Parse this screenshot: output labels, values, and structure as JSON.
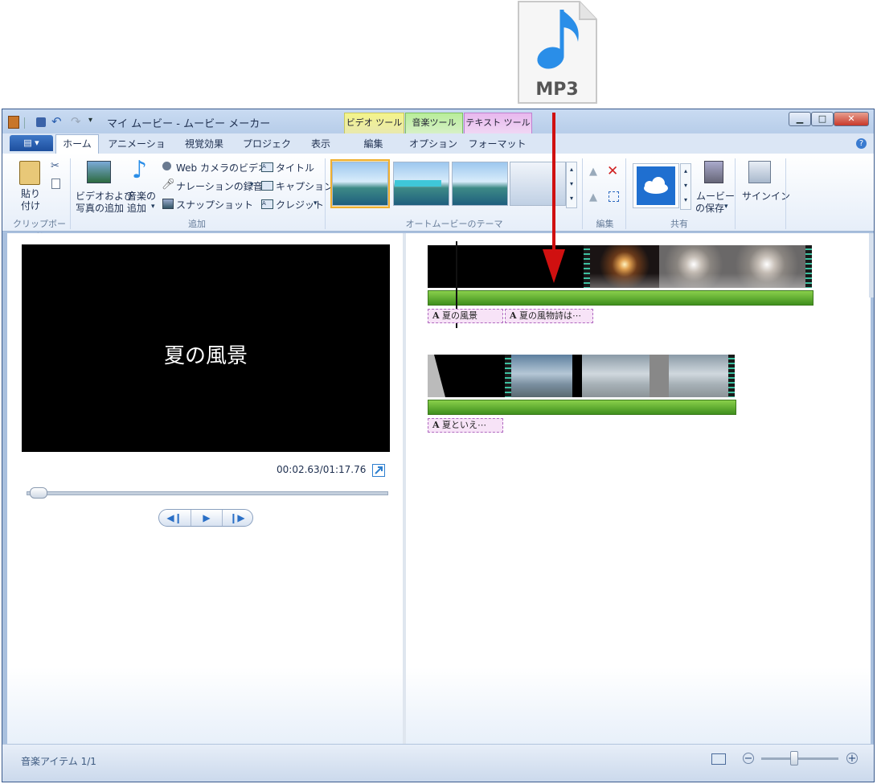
{
  "file_icon": {
    "label": "MP3",
    "accent": "#2a8ee8"
  },
  "window": {
    "title": "マイ ムービー - ムービー メーカー"
  },
  "context_tabs": {
    "video_tools": "ビデオ ツール",
    "music_tools": "音楽ツール",
    "text_tools": "テキスト ツール"
  },
  "tabs": [
    "ホーム",
    "アニメーション",
    "視覚効果",
    "プロジェクト",
    "表示",
    "編集",
    "オプション",
    "フォーマット"
  ],
  "ribbon": {
    "paste": "貼り\n付け",
    "clipboard_group": "クリップボード",
    "add_video_photo_line1": "ビデオおよび",
    "add_video_photo_line2": "写真の追加",
    "add_music_line1": "音楽の",
    "add_music_line2": "追加",
    "webcam": "Web カメラのビデオ",
    "narration": "ナレーションの録音",
    "snapshot": "スナップショット",
    "title": "タイトル",
    "caption": "キャプション",
    "credits": "クレジット",
    "add_group": "追加",
    "automovie_group": "オートムービーのテーマ",
    "edit_group": "編集",
    "share_group": "共有",
    "save_movie_line1": "ムービー",
    "save_movie_line2": "の保存",
    "sign_in": "サインイン"
  },
  "preview": {
    "text": "夏の風景",
    "timecode": "00:02.63/01:17.76",
    "progress": 0.034
  },
  "storyboard": {
    "row1_captions": [
      "夏の風景",
      "夏の風物詩は⋯"
    ],
    "row2_captions": [
      "夏といえ⋯"
    ]
  },
  "status": {
    "text": "音楽アイテム 1/1",
    "zoom_level": 0.4
  },
  "colors": {
    "arrow": "#d01010",
    "audio": "#4fa52a"
  }
}
